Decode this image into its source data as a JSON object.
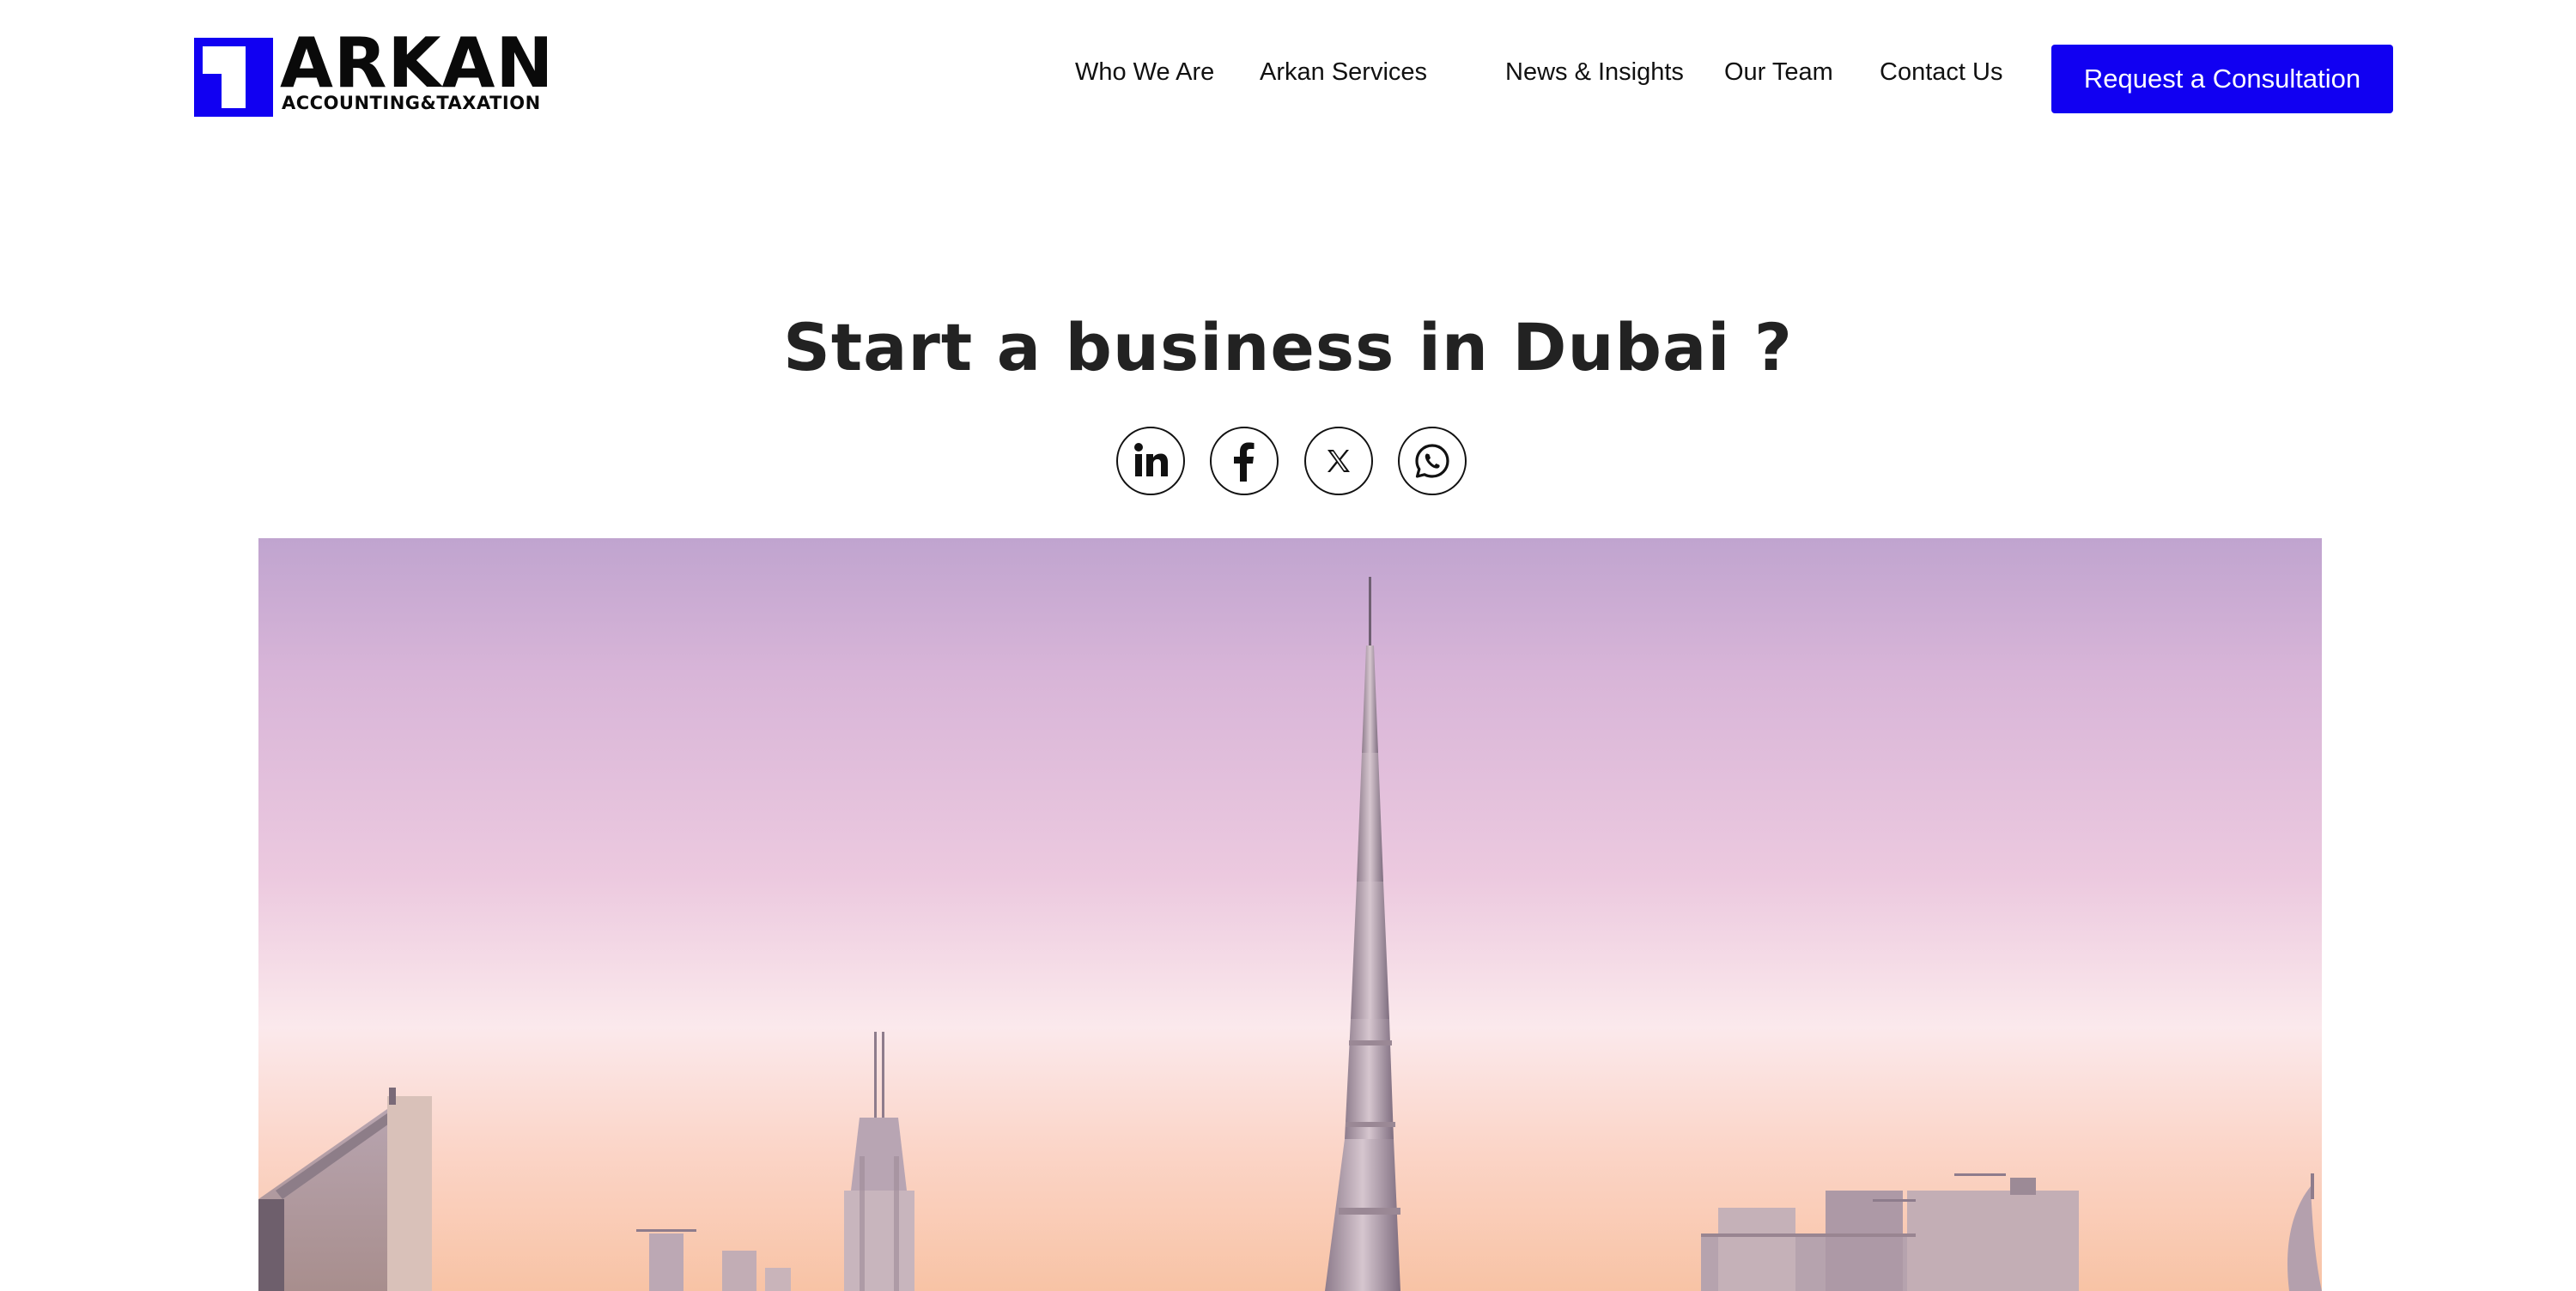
{
  "brand": {
    "name": "ARKAN",
    "tagline": "ACCOUNTING&TAXATION",
    "color": "#1100f2"
  },
  "nav": {
    "items": [
      {
        "label": "Who We Are"
      },
      {
        "label": "Arkan Services"
      },
      {
        "label": "News & Insights"
      },
      {
        "label": "Our Team"
      },
      {
        "label": "Contact Us"
      }
    ],
    "cta_label": "Request a Consultation"
  },
  "main": {
    "title": "Start a business in Dubai ?"
  },
  "share": {
    "icons": [
      "linkedin-icon",
      "facebook-icon",
      "x-icon",
      "whatsapp-icon"
    ]
  },
  "hero": {
    "icon": "dubai-skyline-image"
  }
}
